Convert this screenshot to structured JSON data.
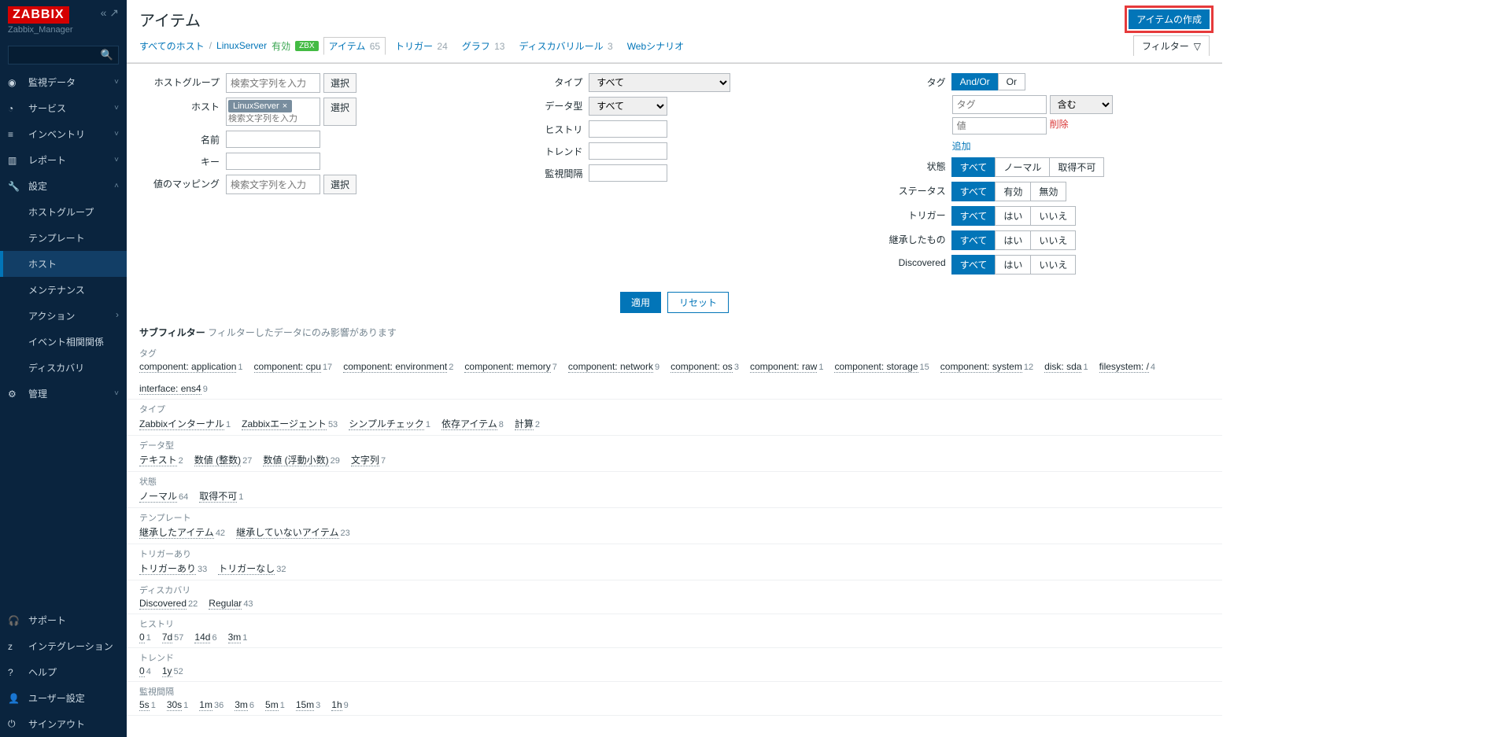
{
  "brand": "ZABBIX",
  "server_name": "Zabbix_Manager",
  "sidebar": {
    "sections": [
      {
        "label": "監視データ",
        "icon": "◉"
      },
      {
        "label": "サービス",
        "icon": "◔"
      },
      {
        "label": "インベントリ",
        "icon": "≡"
      },
      {
        "label": "レポート",
        "icon": "▥"
      },
      {
        "label": "設定",
        "icon": "🔧",
        "open": true
      },
      {
        "label": "管理",
        "icon": "⚙"
      }
    ],
    "config_items": [
      {
        "label": "ホストグループ"
      },
      {
        "label": "テンプレート"
      },
      {
        "label": "ホスト",
        "active": true
      },
      {
        "label": "メンテナンス"
      },
      {
        "label": "アクション",
        "caret": true
      },
      {
        "label": "イベント相関関係"
      },
      {
        "label": "ディスカバリ"
      }
    ],
    "footer": [
      {
        "label": "サポート",
        "icon": "🎧"
      },
      {
        "label": "インテグレーション",
        "icon": "z"
      },
      {
        "label": "ヘルプ",
        "icon": "?"
      },
      {
        "label": "ユーザー設定",
        "icon": "👤"
      },
      {
        "label": "サインアウト",
        "icon": "⏻"
      }
    ]
  },
  "page": {
    "title": "アイテム",
    "create": "アイテムの作成",
    "crumbs": {
      "all_hosts": "すべてのホスト",
      "host": "LinuxServer",
      "enabled": "有効",
      "zbx": "ZBX",
      "items": {
        "label": "アイテム",
        "count": 65,
        "active": true
      },
      "triggers": {
        "label": "トリガー",
        "count": 24
      },
      "graphs": {
        "label": "グラフ",
        "count": 13
      },
      "discovery": {
        "label": "ディスカバリルール",
        "count": 3
      },
      "web": {
        "label": "Webシナリオ"
      }
    },
    "filter_label": "フィルター"
  },
  "filter": {
    "c1": {
      "hostgroup": {
        "label": "ホストグループ",
        "placeholder": "検索文字列を入力",
        "select": "選択"
      },
      "host": {
        "label": "ホスト",
        "chip": "LinuxServer",
        "placeholder": "検索文字列を入力",
        "select": "選択"
      },
      "name": {
        "label": "名前"
      },
      "key": {
        "label": "キー"
      },
      "valmap": {
        "label": "値のマッピング",
        "placeholder": "検索文字列を入力",
        "select": "選択"
      }
    },
    "c2": {
      "type": {
        "label": "タイプ",
        "value": "すべて"
      },
      "data_type": {
        "label": "データ型",
        "value": "すべて"
      },
      "history": {
        "label": "ヒストリ"
      },
      "trend": {
        "label": "トレンド"
      },
      "interval": {
        "label": "監視間隔"
      }
    },
    "c3": {
      "tag": {
        "label": "タグ",
        "andor": "And/Or",
        "or": "Or",
        "tag_ph": "タグ",
        "op": "含む",
        "val_ph": "値",
        "remove": "削除",
        "add": "追加"
      },
      "state": {
        "label": "状態",
        "opts": [
          "すべて",
          "ノーマル",
          "取得不可"
        ]
      },
      "status": {
        "label": "ステータス",
        "opts": [
          "すべて",
          "有効",
          "無効"
        ]
      },
      "trigger": {
        "label": "トリガー",
        "opts": [
          "すべて",
          "はい",
          "いいえ"
        ]
      },
      "inherited": {
        "label": "継承したもの",
        "opts": [
          "すべて",
          "はい",
          "いいえ"
        ]
      },
      "discovered": {
        "label": "Discovered",
        "opts": [
          "すべて",
          "はい",
          "いいえ"
        ]
      }
    },
    "apply": "適用",
    "reset": "リセット"
  },
  "subfilter": {
    "head": "サブフィルター",
    "hint": "フィルターしたデータにのみ影響があります",
    "groups": [
      {
        "cat": "タグ",
        "items": [
          {
            "label": "component: application",
            "n": 1
          },
          {
            "label": "component: cpu",
            "n": 17
          },
          {
            "label": "component: environment",
            "n": 2
          },
          {
            "label": "component: memory",
            "n": 7
          },
          {
            "label": "component: network",
            "n": 9
          },
          {
            "label": "component: os",
            "n": 3
          },
          {
            "label": "component: raw",
            "n": 1
          },
          {
            "label": "component: storage",
            "n": 15
          },
          {
            "label": "component: system",
            "n": 12
          },
          {
            "label": "disk: sda",
            "n": 1
          },
          {
            "label": "filesystem: /",
            "n": 4
          },
          {
            "label": "interface: ens4",
            "n": 9
          }
        ]
      },
      {
        "cat": "タイプ",
        "items": [
          {
            "label": "Zabbixインターナル",
            "n": 1
          },
          {
            "label": "Zabbixエージェント",
            "n": 53
          },
          {
            "label": "シンプルチェック",
            "n": 1
          },
          {
            "label": "依存アイテム",
            "n": 8
          },
          {
            "label": "計算",
            "n": 2
          }
        ]
      },
      {
        "cat": "データ型",
        "items": [
          {
            "label": "テキスト",
            "n": 2
          },
          {
            "label": "数値 (整数)",
            "n": 27
          },
          {
            "label": "数値 (浮動小数)",
            "n": 29
          },
          {
            "label": "文字列",
            "n": 7
          }
        ]
      },
      {
        "cat": "状態",
        "items": [
          {
            "label": "ノーマル",
            "n": 64
          },
          {
            "label": "取得不可",
            "n": 1
          }
        ]
      },
      {
        "cat": "テンプレート",
        "items": [
          {
            "label": "継承したアイテム",
            "n": 42
          },
          {
            "label": "継承していないアイテム",
            "n": 23
          }
        ]
      },
      {
        "cat": "トリガーあり",
        "items": [
          {
            "label": "トリガーあり",
            "n": 33
          },
          {
            "label": "トリガーなし",
            "n": 32
          }
        ]
      },
      {
        "cat": "ディスカバリ",
        "items": [
          {
            "label": "Discovered",
            "n": 22
          },
          {
            "label": "Regular",
            "n": 43
          }
        ]
      },
      {
        "cat": "ヒストリ",
        "items": [
          {
            "label": "0",
            "n": 1
          },
          {
            "label": "7d",
            "n": 57
          },
          {
            "label": "14d",
            "n": 6
          },
          {
            "label": "3m",
            "n": 1
          }
        ]
      },
      {
        "cat": "トレンド",
        "items": [
          {
            "label": "0",
            "n": 4
          },
          {
            "label": "1y",
            "n": 52
          }
        ]
      },
      {
        "cat": "監視間隔",
        "items": [
          {
            "label": "5s",
            "n": 1
          },
          {
            "label": "30s",
            "n": 1
          },
          {
            "label": "1m",
            "n": 36
          },
          {
            "label": "3m",
            "n": 6
          },
          {
            "label": "5m",
            "n": 1
          },
          {
            "label": "15m",
            "n": 3
          },
          {
            "label": "1h",
            "n": 9
          }
        ]
      }
    ]
  }
}
